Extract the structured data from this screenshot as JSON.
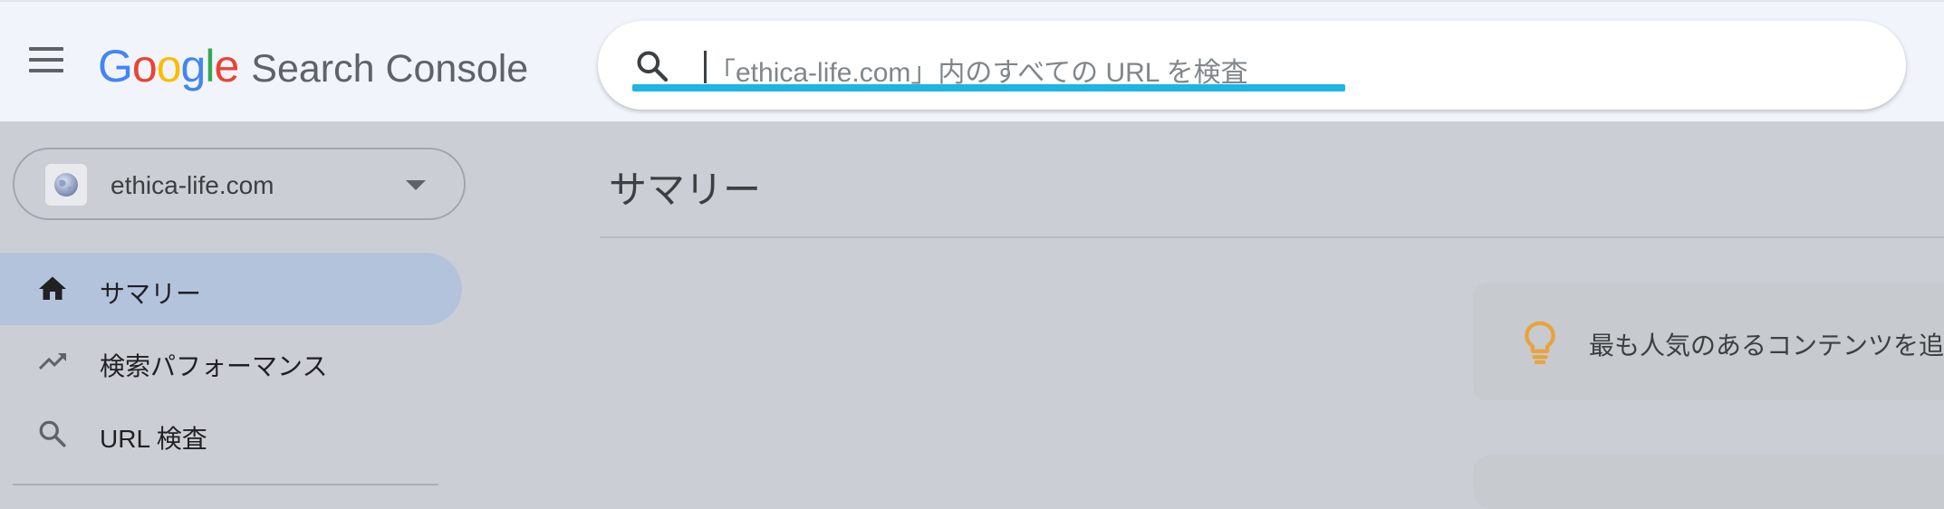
{
  "header": {
    "menu_icon": "hamburger-menu-icon",
    "logo": {
      "brand_letters": [
        {
          "char": "G",
          "color": "#4285F4"
        },
        {
          "char": "o",
          "color": "#EA4335"
        },
        {
          "char": "o",
          "color": "#FBBC05"
        },
        {
          "char": "g",
          "color": "#4285F4"
        },
        {
          "char": "l",
          "color": "#34A853"
        },
        {
          "char": "e",
          "color": "#EA4335"
        }
      ],
      "product": "Search Console"
    },
    "search": {
      "icon": "search-icon",
      "placeholder": "「ethica-life.com」内のすべての URL を検査",
      "underline_color": "#1DB5E6"
    }
  },
  "sidebar": {
    "property": {
      "name": "ethica-life.com",
      "favicon_icon": "globe-icon",
      "dropdown_icon": "caret-down-icon"
    },
    "items": [
      {
        "label": "サマリー",
        "icon": "home-icon",
        "active": true
      },
      {
        "label": "検索パフォーマンス",
        "icon": "trending-up-icon",
        "active": false
      },
      {
        "label": "URL 検査",
        "icon": "search-icon",
        "active": false
      }
    ]
  },
  "main": {
    "title": "サマリー",
    "tip": {
      "icon": "lightbulb-icon",
      "icon_color": "#E8A33D",
      "text": "最も人気のあるコンテンツを追"
    }
  }
}
